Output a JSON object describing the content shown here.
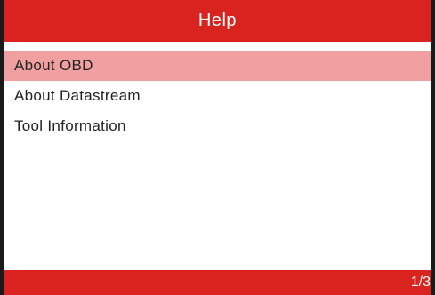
{
  "header": {
    "title": "Help"
  },
  "menu": {
    "items": [
      {
        "label": "About OBD",
        "selected": true
      },
      {
        "label": "About Datastream",
        "selected": false
      },
      {
        "label": "Tool Information",
        "selected": false
      }
    ]
  },
  "footer": {
    "page": "1/3"
  },
  "colors": {
    "accent": "#d8231e",
    "selection": "#f0a0a0",
    "frame": "#1a1a1a"
  }
}
